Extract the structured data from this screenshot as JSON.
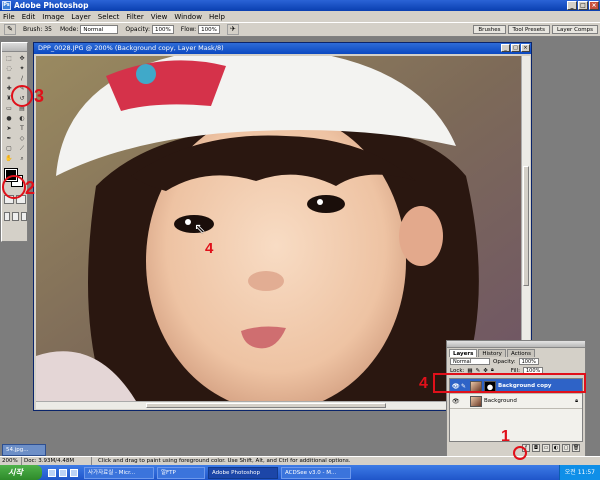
{
  "app": {
    "title": "Adobe Photoshop"
  },
  "menu": [
    "File",
    "Edit",
    "Image",
    "Layer",
    "Select",
    "Filter",
    "View",
    "Window",
    "Help"
  ],
  "options_bar": {
    "brush_label": "Brush:",
    "brush_size": "35",
    "mode_label": "Mode:",
    "mode_value": "Normal",
    "opacity_label": "Opacity:",
    "opacity_value": "100%",
    "flow_label": "Flow:",
    "flow_value": "100%",
    "palette_well": [
      "Brushes",
      "Tool Presets",
      "Layer Comps"
    ]
  },
  "document": {
    "title": "DPP_0028.JPG @ 200% (Background copy, Layer Mask/8)",
    "zoom": "200%",
    "doc_size": "Doc: 3.93M/4.48M"
  },
  "layers_panel": {
    "tabs": [
      "Layers",
      "History",
      "Actions"
    ],
    "blend_mode": "Normal",
    "opacity_label": "Opacity:",
    "opacity_value": "100%",
    "lock_label": "Lock:",
    "fill_label": "Fill:",
    "fill_value": "100%",
    "layers": [
      {
        "name": "Background copy",
        "selected": true
      },
      {
        "name": "Background",
        "selected": false
      }
    ]
  },
  "status_hint": "Click and drag to paint using foreground color.  Use Shift, Alt, and Ctrl for additional options.",
  "minimized_doc": "54.jpg...",
  "taskbar": {
    "start": "시작",
    "tasks": [
      {
        "label": "사가자료실 - Micr...",
        "active": false
      },
      {
        "label": "알FTP",
        "active": false
      },
      {
        "label": "Adobe Photoshop",
        "active": true
      },
      {
        "label": "ACDSee v3.0 - M...",
        "active": false
      }
    ],
    "clock": "오전 11:57"
  },
  "annotations": [
    "1",
    "2",
    "3",
    "4",
    "4"
  ],
  "colors": {
    "annotation_red": "#e0101a",
    "selection_blue": "#2e63c7",
    "title_blue": "#0a3fb0"
  }
}
